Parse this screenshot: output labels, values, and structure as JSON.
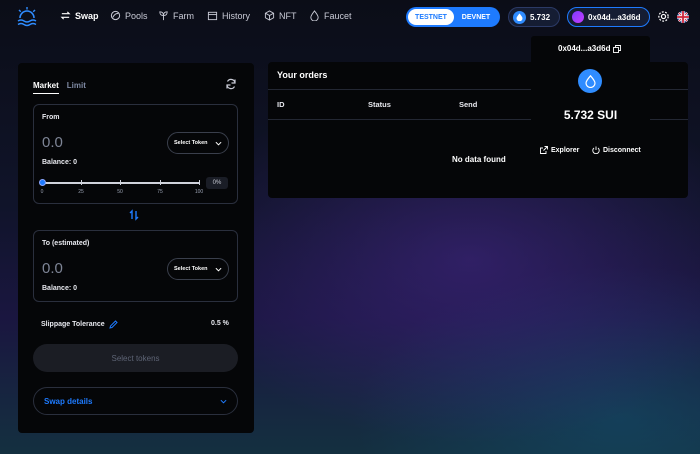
{
  "nav": {
    "items": [
      {
        "label": "Swap",
        "icon": "swap-icon",
        "active": true
      },
      {
        "label": "Pools",
        "icon": "pools-icon"
      },
      {
        "label": "Farm",
        "icon": "farm-icon"
      },
      {
        "label": "History",
        "icon": "calendar-icon"
      },
      {
        "label": "NFT",
        "icon": "cube-icon"
      },
      {
        "label": "Faucet",
        "icon": "droplet-icon"
      }
    ]
  },
  "network": {
    "testnet": "TESTNET",
    "devnet": "DEVNET",
    "selected": "TESTNET"
  },
  "wallet": {
    "balance": "5.732",
    "address": "0x04d...a3d6d"
  },
  "accent": "#1e7bff",
  "swap": {
    "tabs": {
      "market": "Market",
      "limit": "Limit"
    },
    "from": {
      "label": "From",
      "amount": "0.0",
      "select_label": "Select Token",
      "balance": "Balance: 0",
      "slider_ticks": [
        "0",
        "25",
        "50",
        "75",
        "100"
      ],
      "percent": "0%"
    },
    "to": {
      "label": "To (estimated)",
      "amount": "0.0",
      "select_label": "Select Token",
      "balance": "Balance: 0"
    },
    "slippage_label": "Slippage Tolerance",
    "slippage_value": "0.5 %",
    "select_tokens_button": "Select tokens",
    "details_label": "Swap details"
  },
  "orders": {
    "title": "Your orders",
    "columns": [
      "ID",
      "Status",
      "Send"
    ],
    "empty": "No data found"
  },
  "popup": {
    "address": "0x04d...a3d6d",
    "balance": "5.732 SUI",
    "explorer": "Explorer",
    "disconnect": "Disconnect"
  }
}
